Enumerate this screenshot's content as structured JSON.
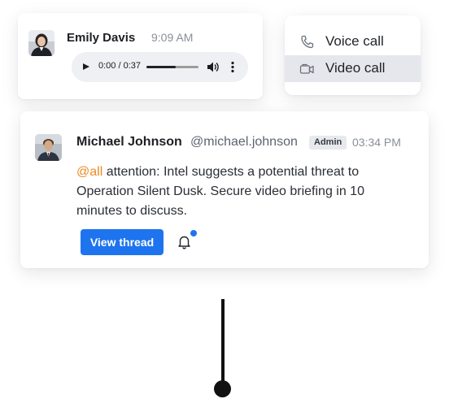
{
  "voice_message": {
    "sender": "Emily Davis",
    "time": "9:09 AM",
    "audio": {
      "time_display": "0:00 / 0:37",
      "progress": 0.56
    }
  },
  "call_menu": {
    "items": [
      {
        "label": "Voice call",
        "icon": "phone-icon"
      },
      {
        "label": "Video call",
        "icon": "video-camera-icon",
        "highlighted": true
      }
    ]
  },
  "message": {
    "sender": "Michael Johnson",
    "handle": "@michael.johnson",
    "badge": "Admin",
    "time": "03:34 PM",
    "mention": "@all",
    "text": " attention: Intel suggests a potential threat to Operation Silent Dusk. Secure video briefing in 10 minutes to discuss.",
    "view_thread_label": "View thread",
    "has_notification": true
  },
  "colors": {
    "accent": "#1e74ee",
    "mention": "#ec8a23",
    "menu_highlight": "#e5e7ec"
  }
}
